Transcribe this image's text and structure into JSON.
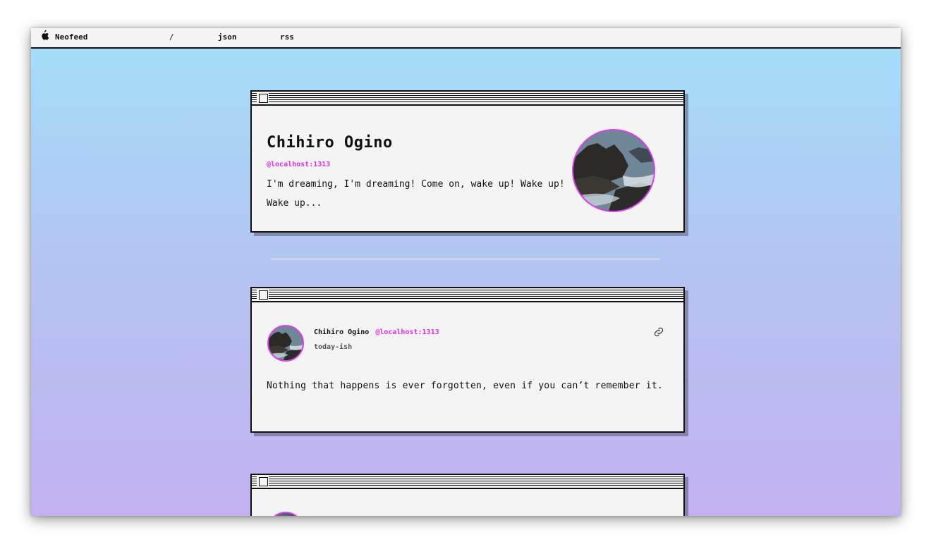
{
  "menubar": {
    "apple_icon": "apple-icon",
    "brand": "Neofeed",
    "slash": "/",
    "json": "json",
    "rss": "rss"
  },
  "profile": {
    "name": "Chihiro Ogino",
    "handle": "@localhost:1313",
    "bio": "I'm dreaming, I'm dreaming! Come on, wake up! Wake up! Wake up..."
  },
  "posts": [
    {
      "author": "Chihiro Ogino",
      "handle": "@localhost:1313",
      "time": "today-ish",
      "body": "Nothing that happens is ever forgotten, even if you can’t remember it.",
      "link_icon": "link-icon"
    }
  ],
  "colors": {
    "accent": "#e02ee0",
    "card_bg": "#f4f4f4",
    "gradient_top": "#a3e0fa",
    "gradient_bottom": "#c3b1ef"
  }
}
